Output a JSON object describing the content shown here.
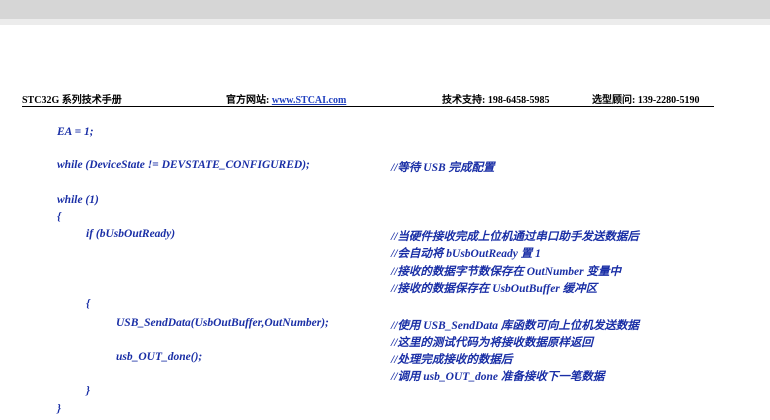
{
  "header": {
    "product": "STC32G 系列技术手册",
    "website_label": "官方网站:",
    "website_link": "www.STCAI.com",
    "support": "技术支持: 198-6458-5985",
    "advisor": "选型顾问: 139-2280-5190"
  },
  "code_lines": [
    "EA = 1;",
    "while (DeviceState != DEVSTATE_CONFIGURED);",
    "while (1)",
    "{",
    "if (bUsbOutReady)",
    "{",
    "USB_SendData(UsbOutBuffer,OutNumber);",
    "usb_OUT_done();",
    "}",
    "}"
  ],
  "comments": [
    "//等待 USB 完成配置",
    "//当硬件接收完成上位机通过串口助手发送数据后",
    "//会自动将 bUsbOutReady 置 1",
    "//接收的数据字节数保存在 OutNumber 变量中",
    "//接收的数据保存在 UsbOutBuffer 缓冲区",
    "//使用 USB_SendData 库函数可向上位机发送数据",
    "//这里的测试代码为将接收数据原样返回",
    "//处理完成接收的数据后",
    "//调用 usb_OUT_done 准备接收下一笔数据"
  ],
  "colors": {
    "code": "#1a2fa6",
    "link": "#1f3fbf",
    "top_band": "#d6d6d6"
  }
}
